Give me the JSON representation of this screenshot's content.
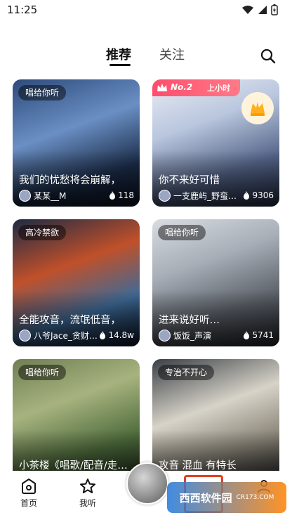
{
  "status_bar": {
    "time": "11:25"
  },
  "tabs": [
    {
      "label": "推荐"
    },
    {
      "label": "关注"
    }
  ],
  "cards": [
    {
      "tag": "唱给你听",
      "title": "我们的忧愁将会崩解，",
      "author": "某某__M",
      "heat": "118"
    },
    {
      "tag": "",
      "title": "你不来好可惜",
      "author": "一支鹿屿_野蛮…",
      "heat": "9306",
      "rank_badge": "No.2",
      "rank_sub": "上小时"
    },
    {
      "tag": "高冷禁欲",
      "title": "全能攻音，流氓低音，",
      "author": "八爷Jace_贪财…",
      "heat": "14.8w"
    },
    {
      "tag": "唱给你听",
      "title": "进来说好听…",
      "author": "饭饭_声演",
      "heat": "5741"
    },
    {
      "tag": "唱给你听",
      "title": "小茶楼《唱歌/配音/走…",
      "author": "",
      "heat": ""
    },
    {
      "tag": "专治不开心",
      "title": "攻音 混血 有特长",
      "author": "",
      "heat": ""
    }
  ],
  "bottom_nav": {
    "home": "首页",
    "mine": "我听"
  },
  "watermark": {
    "text": "西西软件园",
    "sub": "CR173.COM"
  },
  "colors": {
    "accent": "#ff4d6d",
    "heat_icon": "#ffffff",
    "highlight_box": "#e04020"
  }
}
